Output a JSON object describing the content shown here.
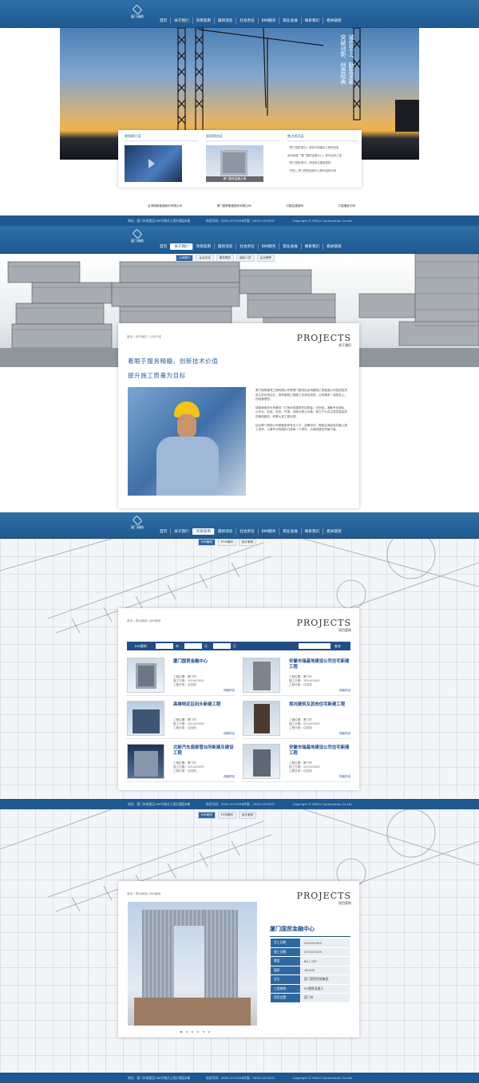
{
  "nav": [
    "首页",
    "关于我们",
    "项目案例",
    "最新消息",
    "社会责任",
    "BIM服务",
    "职业发展",
    "联系我们",
    "相关链接"
  ],
  "logo_text": "厦门瑞助",
  "home": {
    "slogan": [
      "诚信至上、勤思深耕",
      "突破创新、创造经典"
    ],
    "boxes": [
      {
        "title": "视频简介区"
      },
      {
        "title": "案例预览区",
        "caption": "厦门国贸金融大厦"
      },
      {
        "title": "焦点资讯区",
        "news": [
          "「厦门国际银行」荣获中国建设工程鲁班奖",
          "我司承建「厦门国贸金融中心」获评优质工程",
          "「厦门国际银行」获国家住建部表彰",
          "「项目」厦门国贸金融中心顺利结构封顶"
        ]
      }
    ],
    "links": [
      "台湾瑞助营造股份有限公司",
      "厦门国贸集团股份有限公司",
      "中国住建部网",
      "万嘉福官方网"
    ]
  },
  "footer": {
    "address": "地址：厦门市湖里区189号皓天工程分楼层B楼",
    "phone": "电话号码：0592-5372058",
    "fax": "传真：0592-5372057",
    "copyright": "Copyright © REGU Construction Co.Ltd."
  },
  "about": {
    "sub": [
      "公司简介",
      "企业文化",
      "服务理念",
      "组织人员",
      "企业荣誉"
    ],
    "crumb": "首页 | 关于我们 | 公司介绍",
    "en": "PROJECTS",
    "cn": "关于我们",
    "headline1": "着眼于服务精髓，创新技术价值",
    "headline2": "提升施工质量为目标",
    "paras": [
      "厦门瑞助建筑工程有限公司是厦门首批由台湾建筑工程营造公司独资投资设立的外资企业，具有建筑工程施工总承包资质，公司秉承「诚信至上」的经营理念。",
      "瑞助营造多年来秉持「打造优质建筑的实践者」为宗旨，凝聚专业团队，以专业、品质、安全、环境、创新为核心价值，致力于为业主提供高品质的营造服务，积累大量工程实绩。",
      "结合厦门瑞助公司具备各种专业人才，定期培训，借鉴台湾经验并融入施工技术，以最专业的团队打造每一个项目，为海西建设贡献力量。"
    ]
  },
  "projects": {
    "sub": [
      "BIM案例",
      "PCM案例",
      "设计案例"
    ],
    "crumb": "首页 | 项目案例 | BIM案例",
    "en": "PROJECTS",
    "cn": "项目案例",
    "search": {
      "label": "BIM案例",
      "year": "年",
      "month": "月",
      "day": "日",
      "button": "查询"
    },
    "labels": {
      "location": "工程位置",
      "date": "施工日期",
      "type": "工程分类",
      "more": "详细内容"
    },
    "items": [
      {
        "name": "厦门国贸金融中心",
        "location": "厦门市",
        "date": "2014/03/05",
        "type": "住宅用"
      },
      {
        "name": "安徽市瑞基地建设公司住宅新建工程",
        "location": "厦门市",
        "date": "2014/03/05",
        "type": "住宅用"
      },
      {
        "name": "高雄特定区码头新建工程",
        "location": "厦门市",
        "date": "2014/03/05",
        "type": "住宅用"
      },
      {
        "name": "昆坑建筑及其他住宅新建工程",
        "location": "厦门市",
        "date": "2014/03/05",
        "type": "住宅用"
      },
      {
        "name": "北部汽车南部营业所新建及建设工程",
        "location": "厦门市",
        "date": "2014/03/05",
        "type": "住宅用"
      },
      {
        "name": "安徽市瑞基地建设公司住宅新建工程",
        "location": "厦门市",
        "date": "2014/03/05",
        "type": "住宅用"
      }
    ]
  },
  "detail": {
    "sub": [
      "BIM案例",
      "PCM案例",
      "设计案例"
    ],
    "crumb": "首页 | 项目案例 | BIM案例",
    "en": "PROJECTS",
    "cn": "项目案例",
    "title": "厦门国贸金融中心",
    "rows": [
      {
        "k": "开工日期",
        "v": "2014/03/05"
      },
      {
        "k": "竣工日期",
        "v": "2014/03/05"
      },
      {
        "k": "楼层",
        "v": "B4 / 22F"
      },
      {
        "k": "面积",
        "v": "16,945"
      },
      {
        "k": "业主",
        "v": "厦门国贸控股集团"
      },
      {
        "k": "工程结构",
        "v": "RC钢骨混凝土"
      },
      {
        "k": "项目位置",
        "v": "厦门市"
      }
    ]
  }
}
